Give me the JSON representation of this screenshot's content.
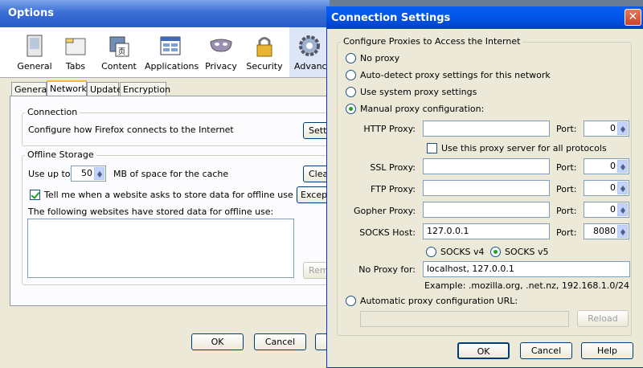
{
  "options": {
    "title": "Options",
    "toolbar": [
      {
        "label": "General",
        "icon": "general-icon"
      },
      {
        "label": "Tabs",
        "icon": "tabs-icon"
      },
      {
        "label": "Content",
        "icon": "content-icon"
      },
      {
        "label": "Applications",
        "icon": "applications-icon"
      },
      {
        "label": "Privacy",
        "icon": "privacy-mask-icon"
      },
      {
        "label": "Security",
        "icon": "security-padlock-icon"
      },
      {
        "label": "Advance",
        "icon": "advanced-gear-icon"
      }
    ],
    "tabs": [
      "General",
      "Network",
      "Update",
      "Encryption"
    ],
    "connection": {
      "group_label": "Connection",
      "description": "Configure how Firefox connects to the Internet",
      "settings_button": "Setti"
    },
    "offline": {
      "group_label": "Offline Storage",
      "use_up_to": "Use up to",
      "cache_value": "50",
      "cache_suffix": "MB of space for the cache",
      "clear_button": "Clear",
      "tell_me": "Tell me when a website asks to store data for offline use",
      "exceptions_button": "Except",
      "list_label": "The following websites have stored data for offline use:",
      "remove_button": "Remo"
    },
    "buttons": {
      "ok": "OK",
      "cancel": "Cancel"
    }
  },
  "connection_settings": {
    "title": "Connection Settings",
    "group_label": "Configure Proxies to Access the Internet",
    "radio_no_proxy": "No proxy",
    "radio_auto_detect": "Auto-detect proxy settings for this network",
    "radio_system": "Use system proxy settings",
    "radio_manual": "Manual proxy configuration:",
    "rows": [
      {
        "label": "HTTP Proxy:",
        "value": "",
        "port_label": "Port:",
        "port": "0"
      },
      {
        "label": "SSL Proxy:",
        "value": "",
        "port_label": "Port:",
        "port": "0"
      },
      {
        "label": "FTP Proxy:",
        "value": "",
        "port_label": "Port:",
        "port": "0"
      },
      {
        "label": "Gopher Proxy:",
        "value": "",
        "port_label": "Port:",
        "port": "0"
      },
      {
        "label": "SOCKS Host:",
        "value": "127.0.0.1",
        "port_label": "Port:",
        "port": "8080"
      }
    ],
    "use_for_all": "Use this proxy server for all protocols",
    "socks_v4": "SOCKS v4",
    "socks_v5": "SOCKS v5",
    "no_proxy_label": "No Proxy for:",
    "no_proxy_value": "localhost, 127.0.0.1",
    "example": "Example: .mozilla.org, .net.nz, 192.168.1.0/24",
    "radio_auto_url": "Automatic proxy configuration URL:",
    "auto_url_value": "",
    "reload_button": "Reload",
    "ok": "OK",
    "cancel": "Cancel",
    "help": "Help"
  },
  "colors": {
    "title_active": "#0058ee",
    "title_inactive": "#7fa4ec",
    "accent_green": "#21a121",
    "selected_tab": "#f2b93b"
  }
}
